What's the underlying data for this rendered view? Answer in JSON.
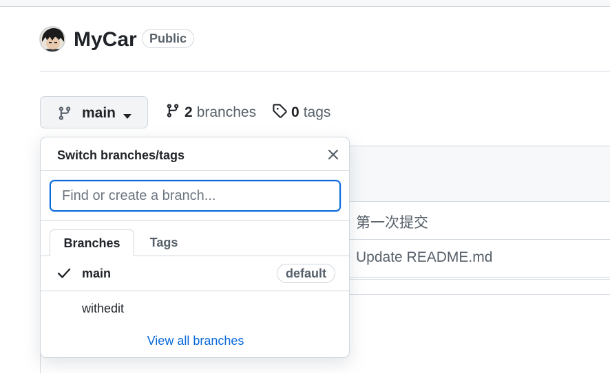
{
  "repo": {
    "name": "MyCar",
    "visibility": "Public"
  },
  "toolbar": {
    "branch_button_label": "main",
    "branches_count": "2",
    "branches_label": "branches",
    "tags_count": "0",
    "tags_label": "tags"
  },
  "files": {
    "rows": [
      {
        "commit_message": "第一次提交"
      },
      {
        "commit_message": "Update README.md"
      }
    ]
  },
  "dropdown": {
    "title": "Switch branches/tags",
    "search_placeholder": "Find or create a branch...",
    "tabs": [
      {
        "label": "Branches",
        "selected": true
      },
      {
        "label": "Tags",
        "selected": false
      }
    ],
    "branches": [
      {
        "name": "main",
        "selected": true,
        "badge": "default"
      },
      {
        "name": "withedit",
        "selected": false,
        "badge": ""
      }
    ],
    "view_all_label": "View all branches"
  },
  "colors": {
    "accent": "#0969da",
    "border": "#d0d7de",
    "muted": "#57606a"
  },
  "icons": [
    "avatar",
    "git-branch-icon",
    "caret-down-icon",
    "tag-icon",
    "close-icon",
    "check-icon"
  ]
}
